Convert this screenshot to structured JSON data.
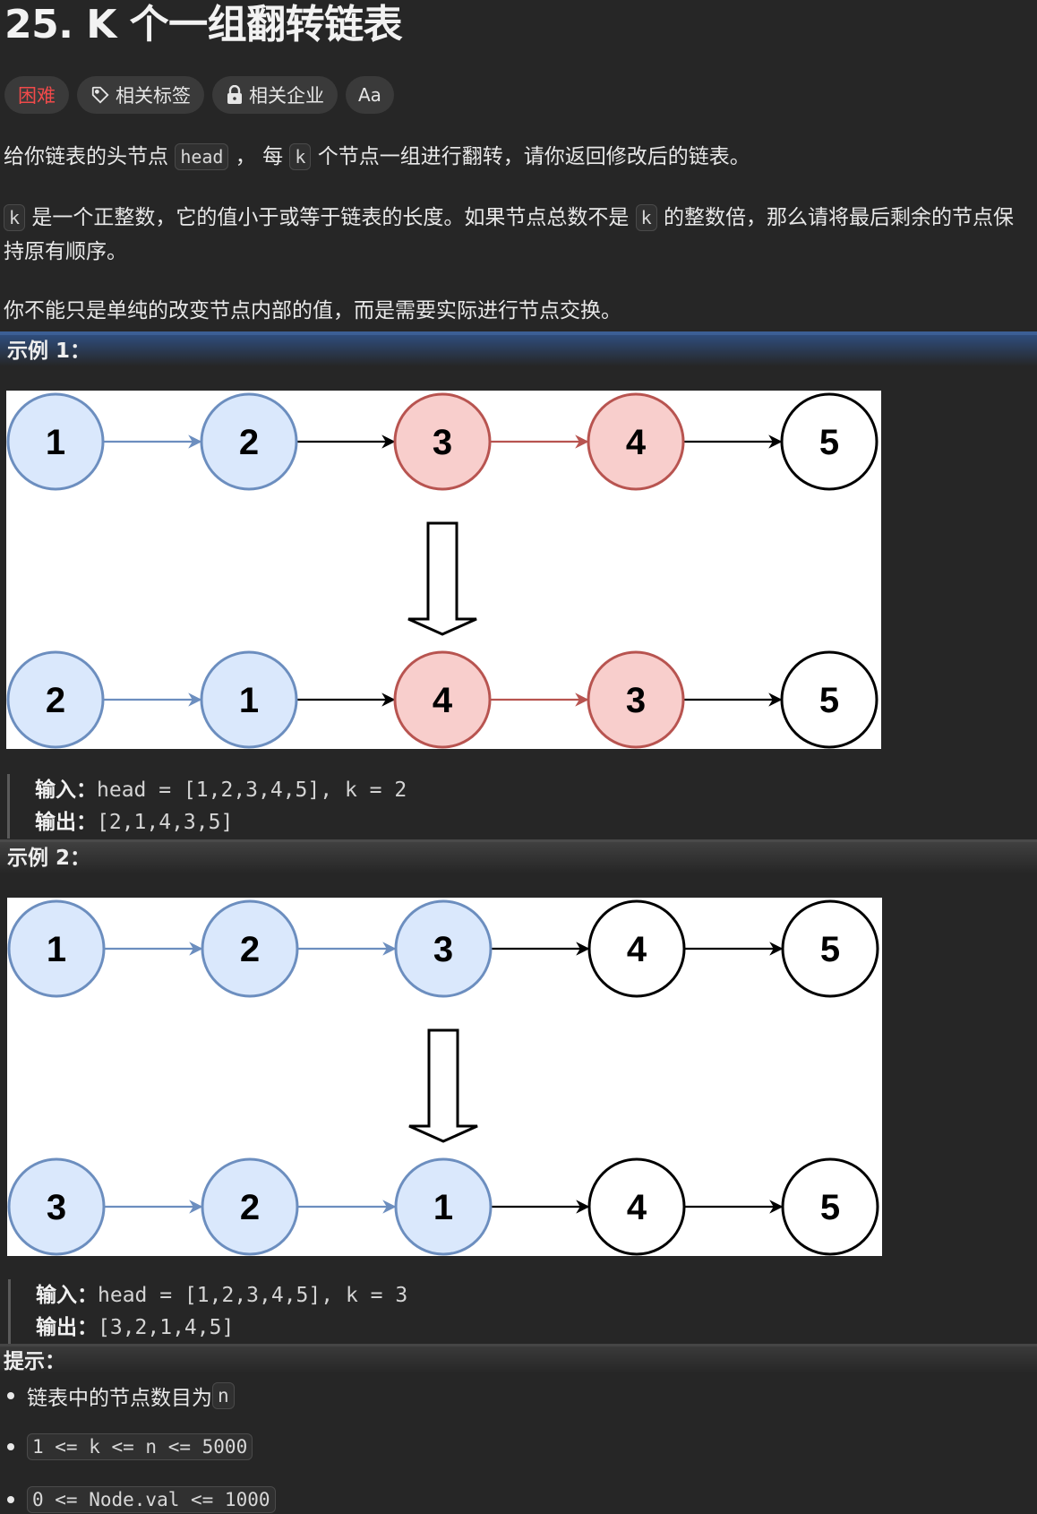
{
  "title": "25. K 个一组翻转链表",
  "tags": {
    "difficulty": "困难",
    "topics": "相关标签",
    "companies": "相关企业",
    "font_icon": "Aa"
  },
  "description": {
    "p1_a": "给你链表的头节点 ",
    "p1_code1": "head",
    "p1_b": " ， 每 ",
    "p1_code2": "k",
    "p1_c": " 个节点一组进行翻转，请你返回修改后的链表。",
    "p2_code1": "k",
    "p2_a": " 是一个正整数，它的值小于或等于链表的长度。如果节点总数不是 ",
    "p2_code2": "k",
    "p2_b": " 的整数倍，那么请将最后剩余的节点保持原有顺序。",
    "p3": "你不能只是单纯的改变节点内部的值，而是需要实际进行节点交换。"
  },
  "examples": [
    {
      "label": "示例 1：",
      "input_label": "输入：",
      "input": "head = [1,2,3,4,5], k = 2",
      "output_label": "输出：",
      "output": "[2,1,4,3,5]",
      "top_row": [
        {
          "v": "1",
          "c": "blue"
        },
        {
          "v": "2",
          "c": "blue"
        },
        {
          "v": "3",
          "c": "red"
        },
        {
          "v": "4",
          "c": "red"
        },
        {
          "v": "5",
          "c": "white"
        }
      ],
      "bottom_row": [
        {
          "v": "2",
          "c": "blue"
        },
        {
          "v": "1",
          "c": "blue"
        },
        {
          "v": "4",
          "c": "red"
        },
        {
          "v": "3",
          "c": "red"
        },
        {
          "v": "5",
          "c": "white"
        }
      ]
    },
    {
      "label": "示例 2：",
      "input_label": "输入：",
      "input": "head = [1,2,3,4,5], k = 3",
      "output_label": "输出：",
      "output": "[3,2,1,4,5]",
      "top_row": [
        {
          "v": "1",
          "c": "blue"
        },
        {
          "v": "2",
          "c": "blue"
        },
        {
          "v": "3",
          "c": "blue"
        },
        {
          "v": "4",
          "c": "white"
        },
        {
          "v": "5",
          "c": "white"
        }
      ],
      "bottom_row": [
        {
          "v": "3",
          "c": "blue"
        },
        {
          "v": "2",
          "c": "blue"
        },
        {
          "v": "1",
          "c": "blue"
        },
        {
          "v": "4",
          "c": "white"
        },
        {
          "v": "5",
          "c": "white"
        }
      ]
    }
  ],
  "hints": {
    "label": "提示：",
    "h1_text": "链表中的节点数目为 ",
    "h1_code": "n",
    "h2_code": "1 <= k <= n <= 5000",
    "h3_code": "0 <= Node.val <= 1000"
  },
  "colors": {
    "blue_fill": "#dae8fc",
    "blue_stroke": "#6c8ebf",
    "red_fill": "#f8cecc",
    "red_stroke": "#b85450",
    "white_fill": "#ffffff",
    "white_stroke": "#000000",
    "difficulty_hard": "#f14a4a"
  }
}
